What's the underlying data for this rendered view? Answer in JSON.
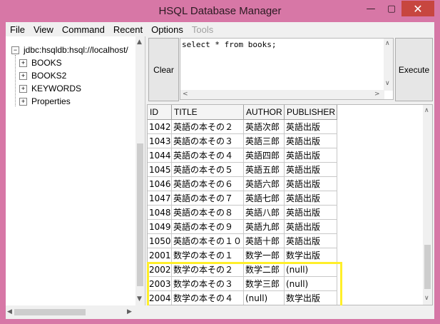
{
  "window": {
    "title": "HSQL Database Manager",
    "minimize": "—",
    "maximize": "▢",
    "close": "✕"
  },
  "menu": [
    {
      "label": "File",
      "enabled": true
    },
    {
      "label": "View",
      "enabled": true
    },
    {
      "label": "Command",
      "enabled": true
    },
    {
      "label": "Recent",
      "enabled": true
    },
    {
      "label": "Options",
      "enabled": true
    },
    {
      "label": "Tools",
      "enabled": false
    }
  ],
  "tree": {
    "root": "jdbc:hsqldb:hsql://localhost/",
    "nodes": [
      "BOOKS",
      "BOOKS2",
      "KEYWORDS",
      "Properties"
    ]
  },
  "toolbar": {
    "clear_label": "Clear",
    "execute_label": "Execute"
  },
  "sql": {
    "text": "select * from books;"
  },
  "results": {
    "columns": [
      "ID",
      "TITLE",
      "AUTHOR",
      "PUBLISHER"
    ],
    "rows": [
      [
        "1042",
        "英語の本その２",
        "英語次郎",
        "英語出版"
      ],
      [
        "1043",
        "英語の本その３",
        "英語三郎",
        "英語出版"
      ],
      [
        "1044",
        "英語の本その４",
        "英語四郎",
        "英語出版"
      ],
      [
        "1045",
        "英語の本その５",
        "英語五郎",
        "英語出版"
      ],
      [
        "1046",
        "英語の本その６",
        "英語六郎",
        "英語出版"
      ],
      [
        "1047",
        "英語の本その７",
        "英語七郎",
        "英語出版"
      ],
      [
        "1048",
        "英語の本その８",
        "英語八郎",
        "英語出版"
      ],
      [
        "1049",
        "英語の本その９",
        "英語九郎",
        "英語出版"
      ],
      [
        "1050",
        "英語の本その１０",
        "英語十郎",
        "英語出版"
      ],
      [
        "2001",
        "数学の本その１",
        "数学一郎",
        "数学出版"
      ],
      [
        "2002",
        "数学の本その２",
        "数学二郎",
        "(null)"
      ],
      [
        "2003",
        "数学の本その３",
        "数学三郎",
        "(null)"
      ],
      [
        "2004",
        "数学の本その４",
        "(null)",
        "数学出版"
      ]
    ]
  },
  "colors": {
    "frame": "#d777a6",
    "close": "#c7463f",
    "highlight": "#ffef2a"
  }
}
